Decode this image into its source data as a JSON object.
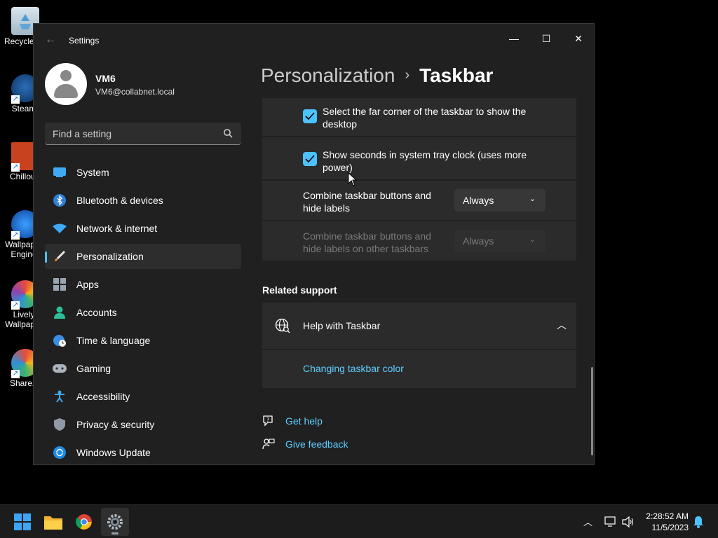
{
  "desktop": {
    "icons": [
      {
        "label": "Recycle Bin"
      },
      {
        "label": "Steam"
      },
      {
        "label": "Chillout"
      },
      {
        "label": "Wallpaper Engine"
      },
      {
        "label": "Lively Wallpaper"
      },
      {
        "label": "ShareX"
      }
    ]
  },
  "window": {
    "title": "Settings",
    "minimize": "—",
    "maximize": "☐",
    "close": "✕"
  },
  "profile": {
    "name": "VM6",
    "email": "VM6@collabnet.local"
  },
  "search": {
    "placeholder": "Find a setting"
  },
  "nav": {
    "items": [
      {
        "label": "System",
        "icon": "system-icon"
      },
      {
        "label": "Bluetooth & devices",
        "icon": "bluetooth-icon"
      },
      {
        "label": "Network & internet",
        "icon": "wifi-icon"
      },
      {
        "label": "Personalization",
        "icon": "brush-icon",
        "active": true
      },
      {
        "label": "Apps",
        "icon": "apps-icon"
      },
      {
        "label": "Accounts",
        "icon": "accounts-icon"
      },
      {
        "label": "Time & language",
        "icon": "globe-clock-icon"
      },
      {
        "label": "Gaming",
        "icon": "gamepad-icon"
      },
      {
        "label": "Accessibility",
        "icon": "accessibility-icon"
      },
      {
        "label": "Privacy & security",
        "icon": "shield-icon"
      },
      {
        "label": "Windows Update",
        "icon": "update-icon"
      }
    ]
  },
  "breadcrumb": {
    "parent": "Personalization",
    "separator": "›",
    "current": "Taskbar"
  },
  "behaviors": {
    "far_corner": {
      "label": "Select the far corner of the taskbar to show the desktop",
      "checked": true
    },
    "seconds": {
      "label": "Show seconds in system tray clock (uses more power)",
      "checked": true
    },
    "combine": {
      "label": "Combine taskbar buttons and hide labels",
      "value": "Always"
    },
    "combine_other": {
      "label": "Combine taskbar buttons and hide labels on other taskbars",
      "value": "Always",
      "disabled": true
    }
  },
  "related": {
    "title": "Related support",
    "help_title": "Help with Taskbar",
    "help_link": "Changing taskbar color"
  },
  "footer_links": {
    "get_help": "Get help",
    "give_feedback": "Give feedback"
  },
  "taskbar": {
    "time": "2:28:52 AM",
    "date": "11/5/2023"
  },
  "colors": {
    "accent": "#4cc2ff",
    "link": "#60cdff",
    "window_bg": "#202020",
    "card_bg": "#2b2b2b"
  }
}
